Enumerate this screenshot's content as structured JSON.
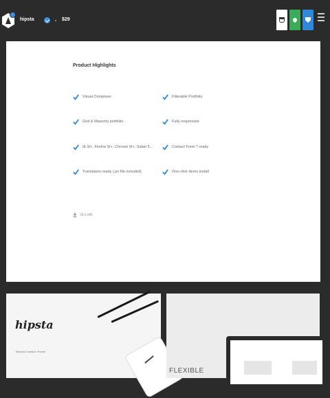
{
  "header": {
    "product_name": "hipsta",
    "author_label": "",
    "price": "$29"
  },
  "highlights": {
    "title": "Product Highlights",
    "features_left": [
      "Visual Composer",
      "Grid & Masonry portfolio",
      "IE 9/+, Firefox 9/+, Chrome 9/+, Safari 5...",
      "Translation ready (.po file included)"
    ],
    "features_right": [
      "Filterable Portfolio",
      "Fully responsive",
      "Contact Form 7 ready",
      "One-click demo install"
    ],
    "downloads": "28.6 MB"
  },
  "previews": {
    "brand": "hipsta",
    "tagline": "Minimal Creative Theme",
    "flex_label": "FLEXIBLE"
  },
  "colors": {
    "topbar": "#2b2b2b",
    "check": "#2f88d8",
    "green_button": "#3aab5a",
    "blue_button": "#2f88d8"
  }
}
